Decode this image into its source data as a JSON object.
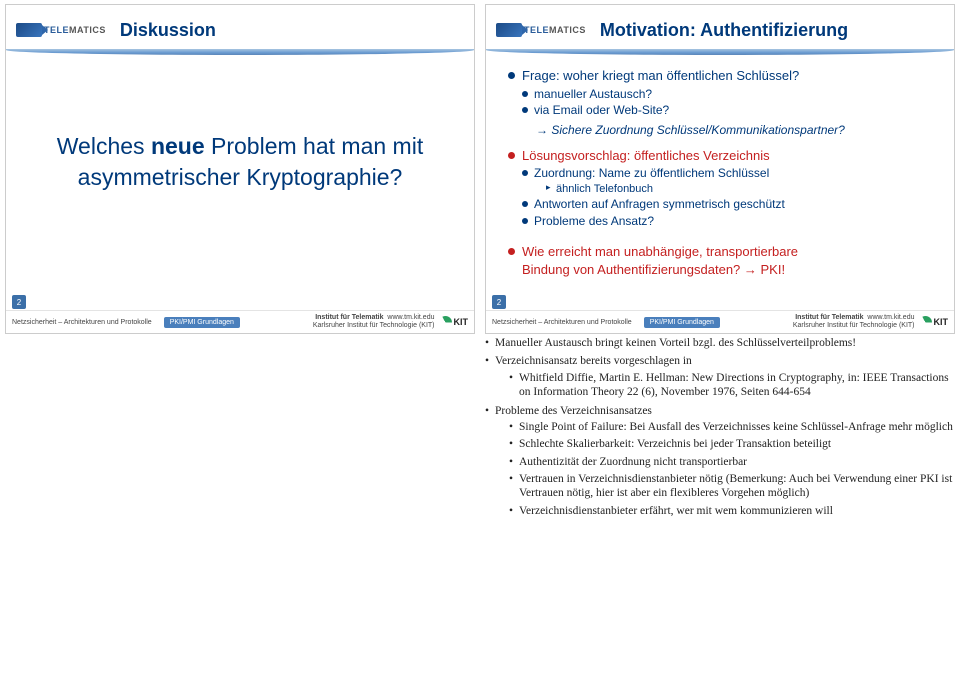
{
  "slideLeft": {
    "pageNumber": "2",
    "logo": {
      "tele": "TELE",
      "matics": "MATICS"
    },
    "title": "Diskussion",
    "question_l1": "Welches ",
    "question_bold": "neue",
    "question_l1b": " Problem hat man mit",
    "question_l2": "asymmetrischer Kryptographie?"
  },
  "slideRight": {
    "pageNumber": "2",
    "logo": {
      "tele": "TELE",
      "matics": "MATICS"
    },
    "title": "Motivation: Authentifizierung",
    "b1": "Frage: woher kriegt man öffentlichen Schlüssel?",
    "b1a": "manueller Austausch?",
    "b1b": "via Email oder Web-Site?",
    "b1arrow": "Sichere Zuordnung Schlüssel/Kommunikationspartner?",
    "b2": "Lösungsvorschlag: öffentliches Verzeichnis",
    "b2a": "Zuordnung: Name zu öffentlichem Schlüssel",
    "b2a1": "ähnlich Telefonbuch",
    "b2b": "Antworten auf Anfragen symmetrisch geschützt",
    "b2c": "Probleme des Ansatz?",
    "b3a": "Wie erreicht man unabhängige, transportierbare",
    "b3b": "Bindung von Authentifizierungsdaten? → PKI!"
  },
  "footer": {
    "left": "Netzsicherheit – Architekturen und Protokolle",
    "mid": "PKI/PMI Grundlagen",
    "inst1": "Institut für Telematik",
    "inst2": "Karlsruher Institut für Technologie (KIT)",
    "url": "www.tm.kit.edu",
    "kit": "KIT"
  },
  "notes": {
    "n1": "Manueller Austausch bringt keinen Vorteil bzgl. des Schlüsselverteilproblems!",
    "n2": "Verzeichnisansatz bereits vorgeschlagen in",
    "n2a": "Whitfield Diffie, Martin E. Hellman: New Directions in Cryptography, in: IEEE Transactions on Information Theory 22 (6), November 1976, Seiten 644-654",
    "n3": "Probleme des Verzeichnisansatzes",
    "n3a": "Single Point of Failure: Bei Ausfall des Verzeichnisses keine Schlüssel-Anfrage mehr möglich",
    "n3b": "Schlechte Skalierbarkeit: Verzeichnis bei jeder Transaktion beteiligt",
    "n3c": "Authentizität der Zuordnung nicht transportierbar",
    "n3d": "Vertrauen in Verzeichnisdienstanbieter nötig (Bemerkung: Auch bei Verwendung einer PKI ist Vertrauen nötig, hier ist aber ein flexibleres Vorgehen möglich)",
    "n3e": "Verzeichnisdienstanbieter erfährt, wer mit wem kommunizieren will"
  }
}
